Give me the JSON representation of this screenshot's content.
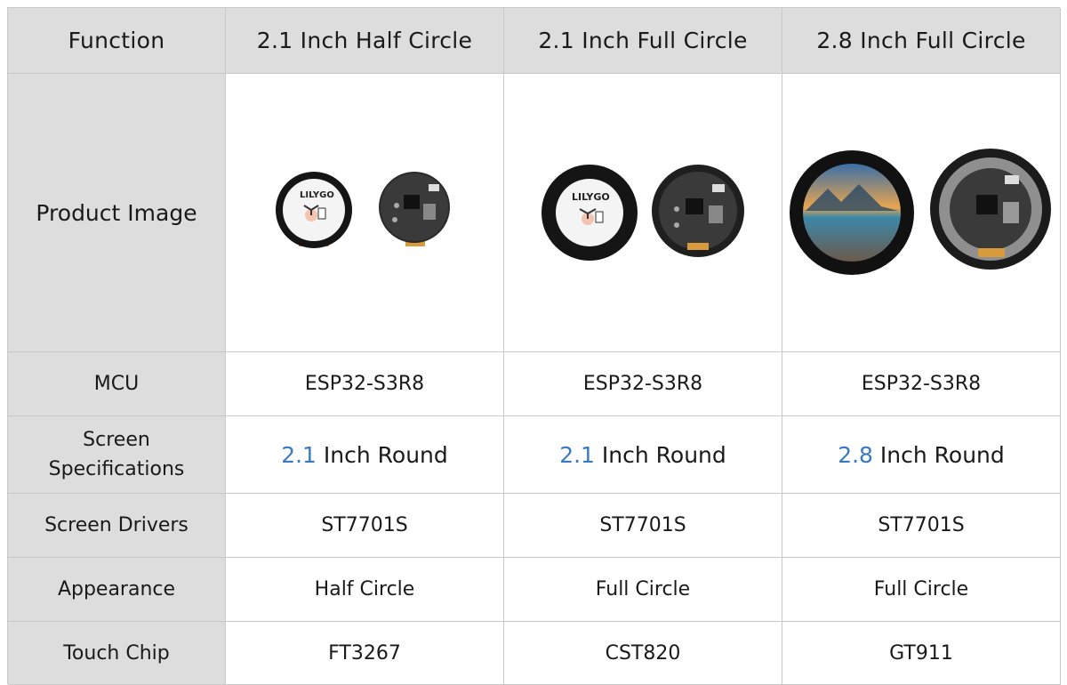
{
  "headers": [
    "Function",
    "2.1 Inch Half Circle",
    "2.1 Inch Full Circle",
    "2.8 Inch Full Circle"
  ],
  "rows": {
    "product_image": {
      "label": "Product Image",
      "logo_text": "LILYGO"
    },
    "mcu": {
      "label": "MCU",
      "values": [
        "ESP32-S3R8",
        "ESP32-S3R8",
        "ESP32-S3R8"
      ]
    },
    "screen_spec": {
      "label_line1": "Screen",
      "label_line2": "Specifications",
      "values": [
        {
          "size": "2.1",
          "rest": " Inch Round"
        },
        {
          "size": "2.1",
          "rest": " Inch Round"
        },
        {
          "size": "2.8",
          "rest": " Inch Round"
        }
      ]
    },
    "screen_drivers": {
      "label": "Screen Drivers",
      "values": [
        "ST7701S",
        "ST7701S",
        "ST7701S"
      ]
    },
    "appearance": {
      "label": "Appearance",
      "values": [
        "Half Circle",
        "Full Circle",
        "Full Circle"
      ]
    },
    "touch_chip": {
      "label": "Touch Chip",
      "values": [
        "FT3267",
        "CST820",
        "GT911"
      ]
    }
  },
  "colors": {
    "header_bg": "#dddddd",
    "border": "#c9c9c9",
    "accent_blue": "#3b78c2"
  }
}
